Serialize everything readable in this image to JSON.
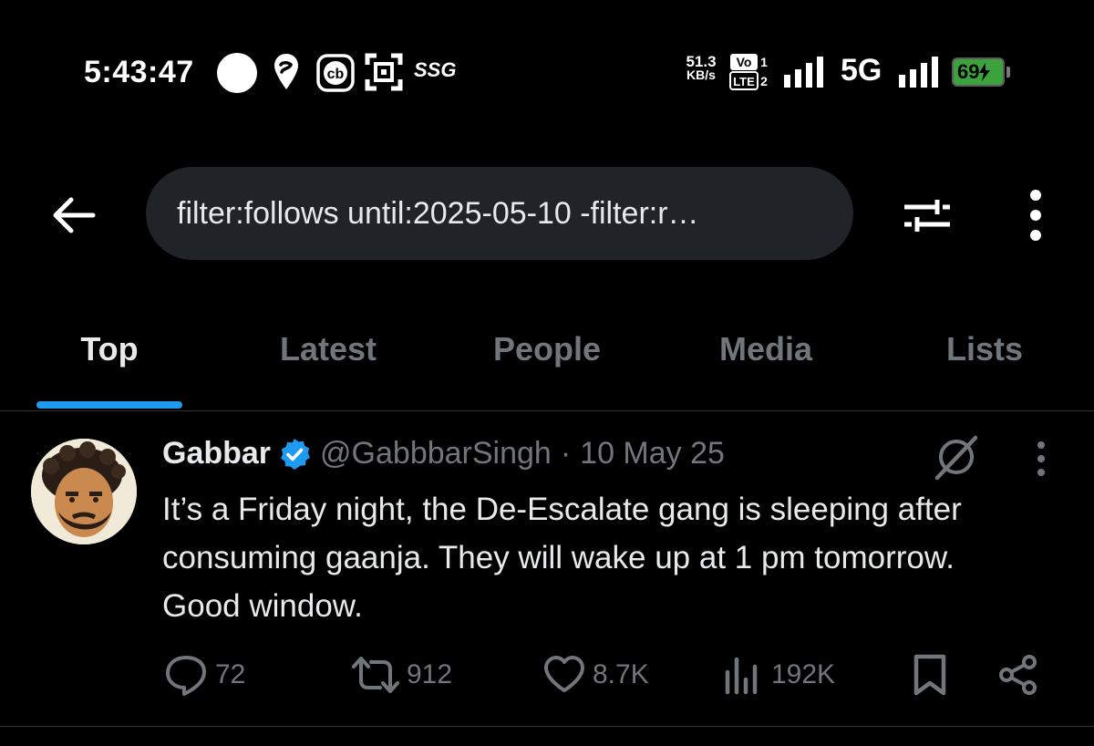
{
  "status_bar": {
    "time": "5:43:47",
    "app_label": "SSG",
    "net_speed_value": "51.3",
    "net_speed_unit": "KB/s",
    "volte_top": "Vo",
    "volte_top_num": "1",
    "volte_bottom": "LTE",
    "volte_bottom_num": "2",
    "network": "5G",
    "battery": "69",
    "battery_color": "#3ca33c"
  },
  "search": {
    "query": "filter:follows until:2025-05-10 -filter:r…"
  },
  "tabs": [
    {
      "label": "Top",
      "active": true
    },
    {
      "label": "Latest",
      "active": false
    },
    {
      "label": "People",
      "active": false
    },
    {
      "label": "Media",
      "active": false
    },
    {
      "label": "Lists",
      "active": false
    }
  ],
  "tweet": {
    "name": "Gabbar",
    "handle": "@GabbbarSingh",
    "separator": "·",
    "date": "10 May 25",
    "lines": [
      "It’s a Friday night, the De-Escalate gang is sleeping after",
      "consuming gaanja. They will wake up at 1 pm tomorrow.",
      "Good window."
    ],
    "actions": {
      "replies": "72",
      "reposts": "912",
      "likes": "8.7K",
      "views": "192K"
    }
  },
  "colors": {
    "accent": "#1d9bf0",
    "muted": "#71767b",
    "text": "#e7e9ea",
    "search_bg": "#202327"
  },
  "icons": [
    "back-arrow-icon",
    "search-filter-icon",
    "more-vertical-icon",
    "verified-badge-icon",
    "grok-icon",
    "reply-icon",
    "repost-icon",
    "like-icon",
    "views-icon",
    "bookmark-icon",
    "share-icon"
  ]
}
